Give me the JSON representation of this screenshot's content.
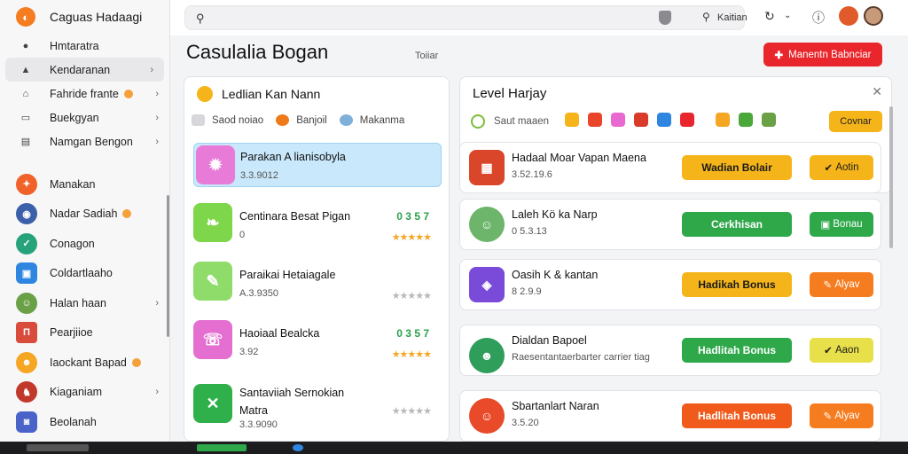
{
  "app": {
    "name": "Caguas Hadaagi"
  },
  "sidebar": {
    "nav": [
      {
        "label": "Hmtaratra",
        "icon": "home-icon",
        "chevron": false,
        "badge": false
      },
      {
        "label": "Kendaranan",
        "icon": "lock-icon",
        "chevron": true,
        "badge": false,
        "active": true
      },
      {
        "label": "Fahride frante",
        "icon": "house-icon",
        "chevron": true,
        "badge": true
      },
      {
        "label": "Buekgyan",
        "icon": "book-icon",
        "chevron": true,
        "badge": false
      },
      {
        "label": "Namgan Bengon",
        "icon": "list-icon",
        "chevron": true,
        "badge": false
      }
    ],
    "apps": [
      {
        "label": "Manakan",
        "icon": "rocket-icon",
        "color": "#f0622a",
        "badge": false,
        "chevron": false
      },
      {
        "label": "Nadar Sadiah",
        "icon": "game-avatar-icon",
        "color": "#3b5fa8",
        "badge": true,
        "chevron": true
      },
      {
        "label": "Conagon",
        "icon": "compass-icon",
        "color": "#26a37a",
        "badge": false,
        "chevron": false
      },
      {
        "label": "Coldartlaaho",
        "icon": "clipboard-icon",
        "color": "#2f86e0",
        "badge": false,
        "chevron": false
      },
      {
        "label": "Halan haan",
        "icon": "character-icon",
        "color": "#6aa046",
        "badge": false,
        "chevron": true
      },
      {
        "label": "Pearjiioe",
        "icon": "temple-icon",
        "color": "#d94b3a",
        "badge": false,
        "chevron": false
      },
      {
        "label": "Iaockant Bapad",
        "icon": "smile-icon",
        "color": "#f5a623",
        "badge": true,
        "chevron": false
      },
      {
        "label": "Kiaganiam",
        "icon": "knight-icon",
        "color": "#c0392b",
        "badge": false,
        "chevron": true
      },
      {
        "label": "Beolanah",
        "icon": "discord-icon",
        "color": "#4a63c9",
        "badge": false,
        "chevron": false
      }
    ]
  },
  "topbar": {
    "search_placeholder": "",
    "search_label": "Kaitian"
  },
  "page": {
    "title": "Casulalia Bogan",
    "subtitle": "Toiiar",
    "cta_label": "Manentn Babnciar"
  },
  "left_panel": {
    "title": "Ledlian Kan Nann",
    "filters": [
      {
        "label": "Saod noiao",
        "color": "#d7d7db"
      },
      {
        "label": "Banjoil",
        "color": "#f07a1a"
      },
      {
        "label": "Makanma",
        "color": "#7fb0d9"
      }
    ],
    "games": [
      {
        "title": "Parakan A lianisobyla",
        "price": "3.3.9012",
        "rank": "",
        "stars": "",
        "thumb_color": "#e87bd8",
        "selected": true
      },
      {
        "title": "Centinara Besat Pigan",
        "price": "0",
        "rank": "0 3 5 7",
        "stars": "★★★★★",
        "thumb_color": "#7ed64a",
        "selected": false
      },
      {
        "title": "Paraikai Hetaiagale",
        "price": "A.3.9350",
        "rank": "",
        "stars": "★★★★★",
        "thumb_color": "#8fdc6a",
        "selected": false
      },
      {
        "title": "Haoiaal Bealcka",
        "price": "3.92",
        "rank": "0 3 5 7",
        "stars": "★★★★★",
        "thumb_color": "#e46fd0",
        "selected": false
      },
      {
        "title": "Santaviiah Sernokian Matra",
        "price": "3.3.9090",
        "rank": "",
        "stars": "★★★★★",
        "thumb_color": "#2fb04a",
        "selected": false
      }
    ]
  },
  "right_panel": {
    "title": "Level Harjay",
    "filter_label": "Saut maaen",
    "sort_label": "Covnar",
    "promos": [
      {
        "title": "Hadaal Moar Vapan Maena",
        "sub": "3.52.19.6",
        "btn": "Wadian Bolair",
        "btn_bg": "#f5b51a",
        "btn_fg": "#1a1a1a",
        "action": "Aotin",
        "action_bg": "#f5b51a",
        "thumb_color": "#d9462a"
      },
      {
        "title": "Laleh Kö ka Narp",
        "sub": "0 5.3.13",
        "btn": "Cerkhisan",
        "btn_bg": "#2fa84a",
        "btn_fg": "#ffffff",
        "action": "Bonau",
        "action_bg": "#2fa84a",
        "thumb_color": "#6cb56a"
      },
      {
        "title": "Oasih K & kantan",
        "sub": "8 2.9.9",
        "btn": "Hadikah Bonus",
        "btn_bg": "#f5b51a",
        "btn_fg": "#1a1a1a",
        "action": "Alyav",
        "action_bg": "#f57c1f",
        "thumb_color": "#7a4ad9"
      },
      {
        "title": "Dialdan Bapoel",
        "sub": "Raesentantaerbarter carrier tiag",
        "btn": "Hadlitah Bonus",
        "btn_bg": "#2fa84a",
        "btn_fg": "#ffffff",
        "action": "Aaon",
        "action_bg": "#e8e04a",
        "thumb_color": "#2f9e5a"
      },
      {
        "title": "Sbartanlart Naran",
        "sub": "3.5.20",
        "btn": "Hadlitah Bonus",
        "btn_bg": "#f05a1a",
        "btn_fg": "#ffffff",
        "action": "Alyav",
        "action_bg": "#f57c1f",
        "thumb_color": "#e84a2a"
      }
    ]
  }
}
